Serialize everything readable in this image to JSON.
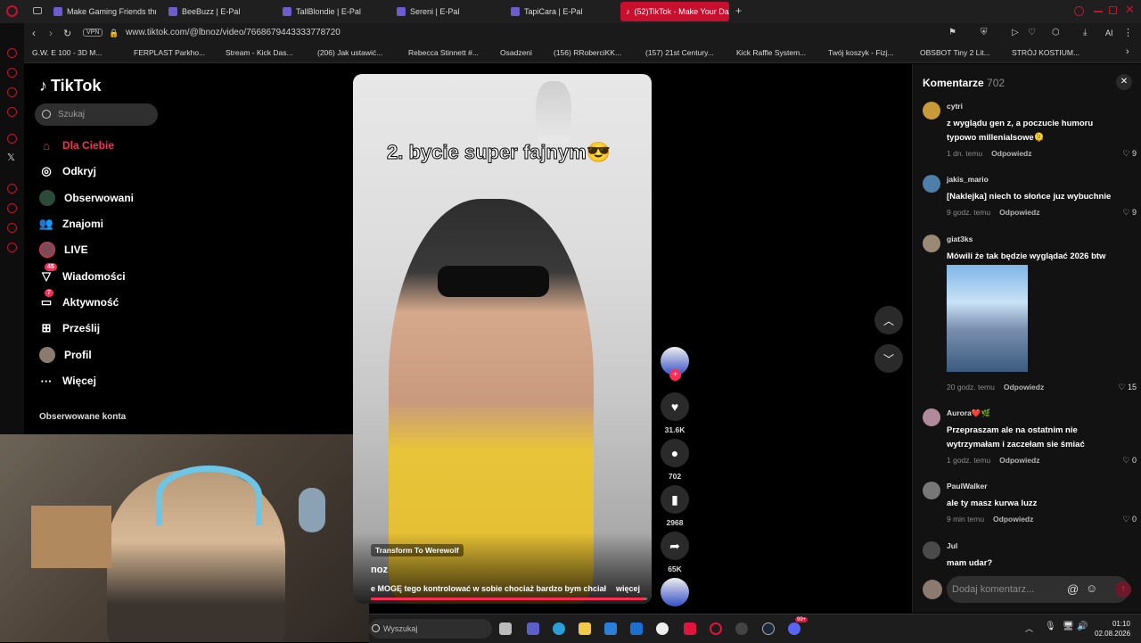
{
  "browser": {
    "tabs": [
      {
        "label": "Make Gaming Friends throu"
      },
      {
        "label": "BeeBuzz | E-Pal"
      },
      {
        "label": "TallBlondie | E-Pal"
      },
      {
        "label": "Sereni | E-Pal"
      },
      {
        "label": "TapiCara | E-Pal"
      },
      {
        "label": "(52)TikTok - Make Your Da"
      }
    ],
    "new_tab": "+",
    "vpn": "VPN",
    "url": "www.tiktok.com/@lbnoz/video/7668679443333778720",
    "ai_label": "AI",
    "bookmarks": [
      "G.W. E 100 - 3D M...",
      "FERPLAST Parkho...",
      "Stream - Kick Das...",
      "(206) Jak ustawić...",
      "Rebecca Stinnett #...",
      "Osadzeni",
      "(156) RRoberciKK...",
      "(157) 21st Century...",
      "Kick Raffle System...",
      "Twój koszyk - Fizj...",
      "OBSBOT Tiny 2 Lit...",
      "STRÓJ KOSTIUM..."
    ]
  },
  "tiktok": {
    "logo": "TikTok",
    "search_placeholder": "Szukaj",
    "nav": [
      {
        "label": "Dla Ciebie",
        "icon": "home-icon"
      },
      {
        "label": "Odkryj",
        "icon": "compass-icon"
      },
      {
        "label": "Obserwowani",
        "icon": "following-icon"
      },
      {
        "label": "Znajomi",
        "icon": "friends-icon"
      },
      {
        "label": "LIVE",
        "icon": "live-icon"
      },
      {
        "label": "Wiadomości",
        "icon": "messages-icon",
        "badge": "45"
      },
      {
        "label": "Aktywność",
        "icon": "activity-icon",
        "badge": "7"
      },
      {
        "label": "Prześlij",
        "icon": "upload-icon"
      },
      {
        "label": "Profil",
        "icon": "profile-icon"
      },
      {
        "label": "Więcej",
        "icon": "more-icon"
      }
    ],
    "followed_title": "Obserwowane konta"
  },
  "video": {
    "caption": "2. bycie super fajnym😎",
    "effect": "Transform To Werewolf",
    "author": "noz",
    "description": "e MOGĘ tego kontrolować w sobie chociaż bardzo bym chciał",
    "more": "więcej",
    "progress": 0.99
  },
  "actions": {
    "likes": "31.6K",
    "comments": "702",
    "saves": "2968",
    "shares": "65K"
  },
  "comments": {
    "title": "Komentarze",
    "count": "702",
    "reply_label": "Odpowiedz",
    "input_placeholder": "Dodaj komentarz...",
    "items": [
      {
        "user": "cytri",
        "text": "z wyglądu gen z, a poczucie humoru typowo millenialsowe🫠",
        "time": "1 dn. temu",
        "likes": "9"
      },
      {
        "user": "jakis_mario",
        "text": "[Naklejka] niech to słońce juz wybuchnie",
        "time": "9 godz. temu",
        "likes": "9"
      },
      {
        "user": "giat3ks",
        "text": "Mówili że tak będzie wyglądać 2026 btw",
        "time": "20 godz. temu",
        "likes": "15"
      },
      {
        "user": "Aurora❤️🌿",
        "text": "Przepraszam ale na ostatnim nie wytrzymałam i zaczełam sie śmiać",
        "time": "1 godz. temu",
        "likes": "0"
      },
      {
        "user": "PaulWalker",
        "text": "ale ty masz kurwa luzz",
        "time": "9 min temu",
        "likes": "0"
      },
      {
        "user": "Jul",
        "text": "mam udar?",
        "time": "",
        "likes": ""
      }
    ]
  },
  "taskbar": {
    "search_placeholder": "Wyszukaj",
    "time": "01:10",
    "date": "02.08.2026",
    "notification_badge": "99+"
  },
  "colors": {
    "tiktok_red": "#fe2c55",
    "opera_red": "#c8102e",
    "panel": "#121212"
  }
}
